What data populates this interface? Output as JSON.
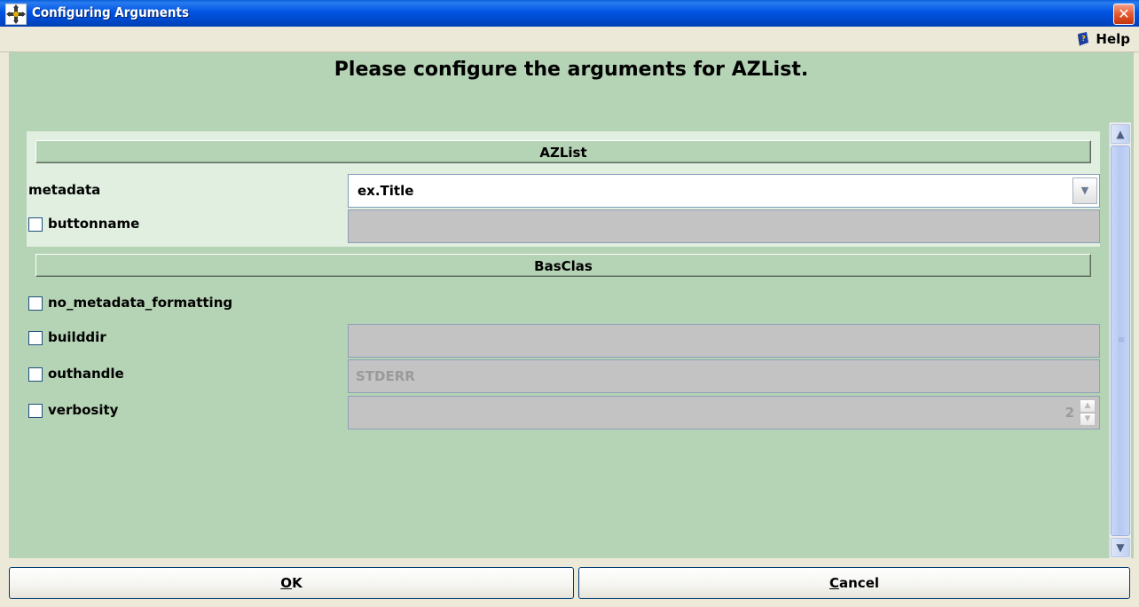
{
  "window": {
    "title": "Configuring Arguments",
    "close_label": "✕"
  },
  "menubar": {
    "help_label": "Help"
  },
  "heading": "Please configure the arguments for AZList.",
  "sections": [
    {
      "label": "AZList",
      "args": [
        {
          "name": "metadata",
          "has_checkbox": false,
          "control": "combo",
          "value": "ex.Title",
          "dropdown_arrow": "▼"
        },
        {
          "name": "buttonname",
          "has_checkbox": true,
          "checked": false,
          "control": "text",
          "value": ""
        }
      ]
    },
    {
      "label": "BasClas",
      "args": [
        {
          "name": "no_metadata_formatting",
          "has_checkbox": true,
          "checked": false,
          "control": "none"
        },
        {
          "name": "builddir",
          "has_checkbox": true,
          "checked": false,
          "control": "text",
          "value": ""
        },
        {
          "name": "outhandle",
          "has_checkbox": true,
          "checked": false,
          "control": "text",
          "value": "STDERR"
        },
        {
          "name": "verbosity",
          "has_checkbox": true,
          "checked": false,
          "control": "spinner",
          "value": "2"
        }
      ]
    }
  ],
  "buttons": {
    "ok_prefix": "O",
    "ok_rest": "K",
    "cancel_prefix": "C",
    "cancel_rest": "ancel"
  },
  "colors": {
    "panel_bg": "#b5d3b5",
    "titlebar": "#0054e3",
    "disabled_field": "#c3c3c3"
  }
}
